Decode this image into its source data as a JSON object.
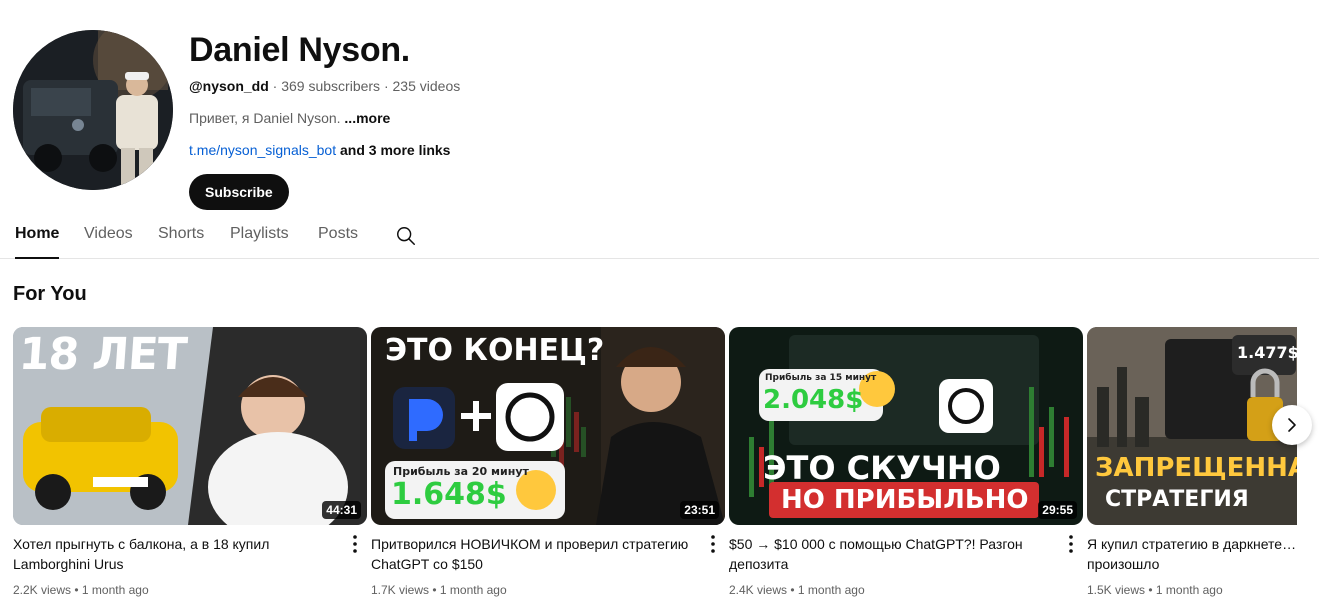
{
  "channel": {
    "name": "Daniel Nyson.",
    "handle": "@nyson_dd",
    "subscribers": "369 subscribers",
    "videos": "235 videos",
    "separator": " · ",
    "description": "Привет, я Daniel Nyson. ",
    "more_label": "...more",
    "link_text": "t.me/nyson_signals_bot",
    "more_links": " and 3 more links",
    "subscribe_label": "Subscribe"
  },
  "tabs": [
    {
      "label": "Home",
      "active": true
    },
    {
      "label": "Videos",
      "active": false
    },
    {
      "label": "Shorts",
      "active": false
    },
    {
      "label": "Playlists",
      "active": false
    },
    {
      "label": "Posts",
      "active": false
    }
  ],
  "section": {
    "title": "For You"
  },
  "videos": [
    {
      "title": "Хотел прыгнуть с балкона, а в 18 купил Lamborghini Urus",
      "views": "2.2K views",
      "age": "1 month ago",
      "duration": "44:31",
      "thumb_text": [
        "18 ЛЕТ"
      ]
    },
    {
      "title": "Притворился НОВИЧКОМ и проверил стратегию ChatGPT со $150",
      "views": "1.7K views",
      "age": "1 month ago",
      "duration": "23:51",
      "thumb_text": [
        "ЭТО КОНЕЦ?",
        "Прибыль за 20 минут",
        "1.648$"
      ]
    },
    {
      "title": "$50 → $10 000 с помощью ChatGPT?! Разгон депозита",
      "views": "2.4K views",
      "age": "1 month ago",
      "duration": "29:55",
      "thumb_text": [
        "Прибыль за 15 минут",
        "2.048$",
        "ЭТО СКУЧНО",
        "НО ПРИБЫЛЬНО"
      ]
    },
    {
      "title": "Я купил стратегию в даркнете… произошло",
      "views": "1.5K views",
      "age": "1 month ago",
      "duration": "",
      "thumb_text": [
        "1.477$",
        "ЗАПРЕЩЕННАЯ",
        "СТРАТЕГИЯ"
      ]
    }
  ],
  "colors": {
    "text_primary": "#0f0f0f",
    "text_secondary": "#606060",
    "link": "#065fd4",
    "subscribe_bg": "#0f0f0f",
    "profit_green": "#2ecc40"
  },
  "icons": [
    "search-icon",
    "more-vert-icon",
    "chevron-right-icon"
  ]
}
